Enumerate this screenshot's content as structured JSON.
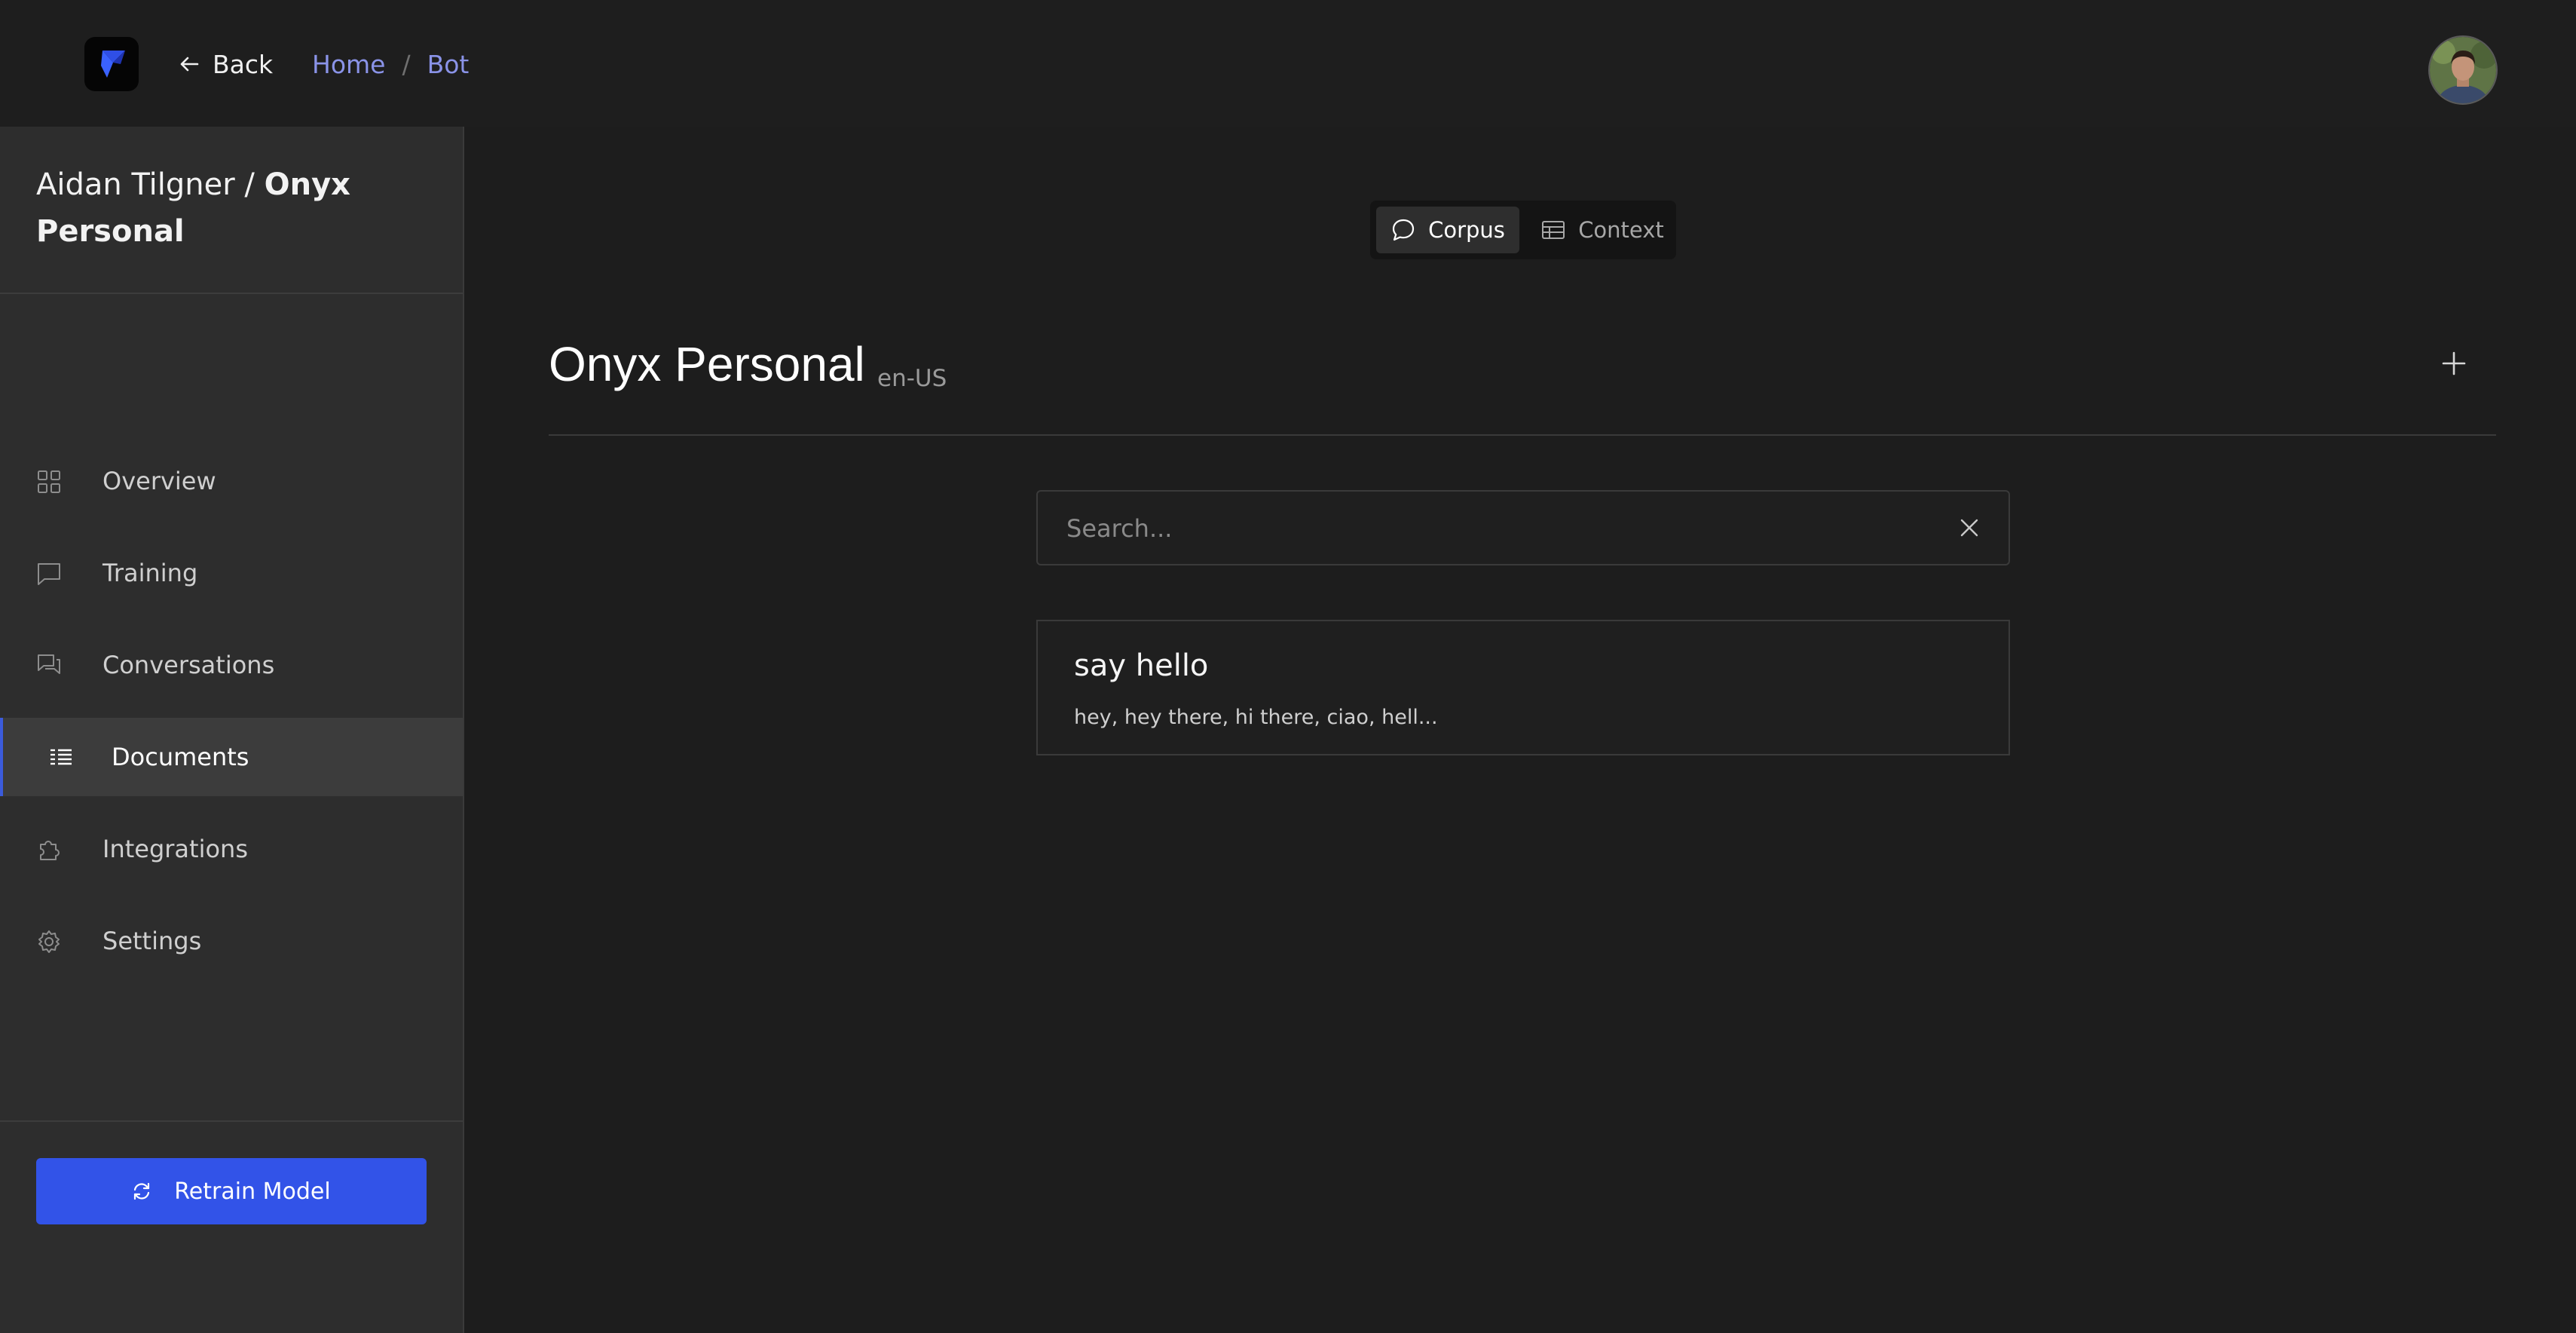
{
  "header": {
    "back_label": "Back",
    "breadcrumbs": [
      "Home",
      "Bot"
    ],
    "breadcrumb_separator": "/"
  },
  "sidebar": {
    "owner": "Aidan Tilgner",
    "separator": "/",
    "project_name": "Onyx Personal",
    "items": [
      {
        "label": "Overview",
        "icon": "grid-icon"
      },
      {
        "label": "Training",
        "icon": "message-square-icon"
      },
      {
        "label": "Conversations",
        "icon": "messages-icon"
      },
      {
        "label": "Documents",
        "icon": "list-icon",
        "active": true
      },
      {
        "label": "Integrations",
        "icon": "puzzle-icon"
      },
      {
        "label": "Settings",
        "icon": "gear-icon"
      }
    ],
    "retrain_label": "Retrain Model"
  },
  "main": {
    "tabs": [
      {
        "label": "Corpus",
        "icon": "chat-bubble-icon",
        "selected": true
      },
      {
        "label": "Context",
        "icon": "table-icon",
        "selected": false
      }
    ],
    "title": "Onyx Personal",
    "locale": "en-US",
    "search": {
      "placeholder": "Search...",
      "value": ""
    },
    "documents": [
      {
        "title": "say hello",
        "preview": "hey, hey there, hi there, ciao, hell..."
      }
    ]
  },
  "colors": {
    "accent": "#3253e8",
    "breadcrumb": "#8a93e8",
    "background": "#1d1d1d",
    "sidebar": "#2d2d2d"
  }
}
